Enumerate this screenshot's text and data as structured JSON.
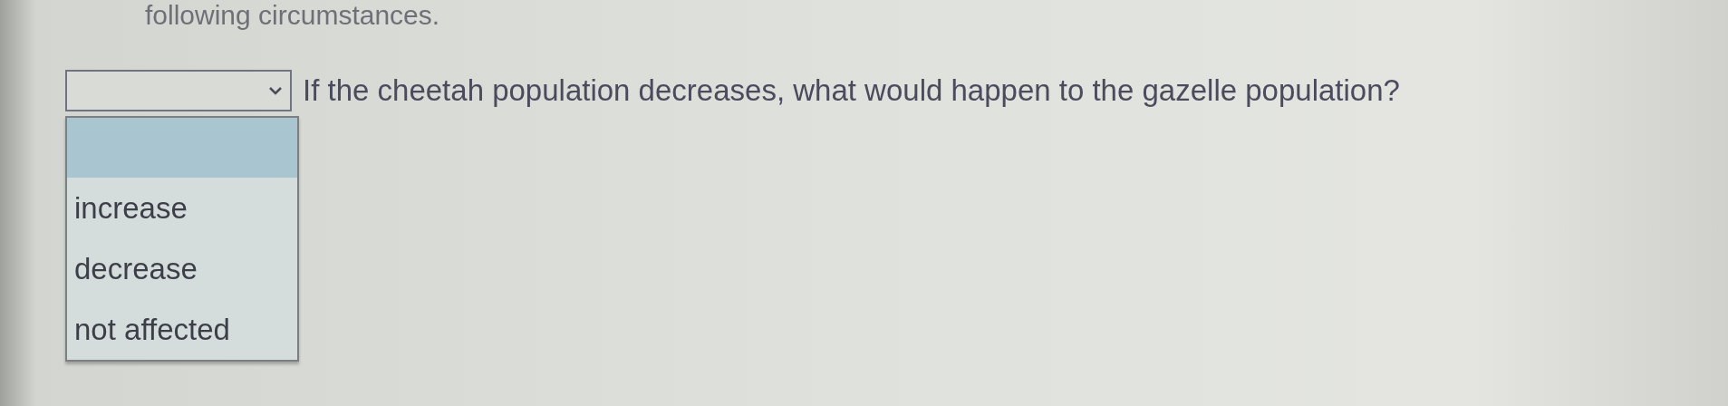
{
  "intro_text": "following circumstances.",
  "question": {
    "text": "If the cheetah population decreases, what would happen to the gazelle population?",
    "dropdown": {
      "expanded": true,
      "options": [
        {
          "label": "increase",
          "selected": false
        },
        {
          "label": "decrease",
          "selected": false
        },
        {
          "label": "not affected",
          "selected": false
        }
      ]
    }
  }
}
